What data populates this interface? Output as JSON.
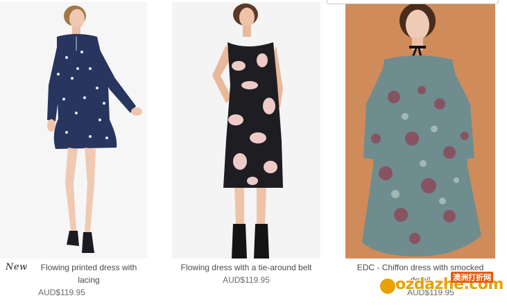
{
  "products": [
    {
      "badge": "New",
      "title": "Flowing printed dress with lacing",
      "price": "AUD$119.95"
    },
    {
      "badge": "",
      "title": "Flowing dress with a tie-around belt",
      "price": "AUD$119.95"
    },
    {
      "badge": "",
      "title": "EDC - Chiffon dress with smocked detail",
      "price": "AUD$119.95"
    }
  ],
  "watermark": {
    "text": "ozdazhe.com",
    "tagline": "澳洲打折网"
  },
  "colors": {
    "navy_dress": "#27355f",
    "black_floral": "#1e1e22",
    "pink_floral": "#efcbc7",
    "teal_floral": "#6f8c8f",
    "orange_bg": "#cf8b5a",
    "watermark": "#e8a100"
  }
}
